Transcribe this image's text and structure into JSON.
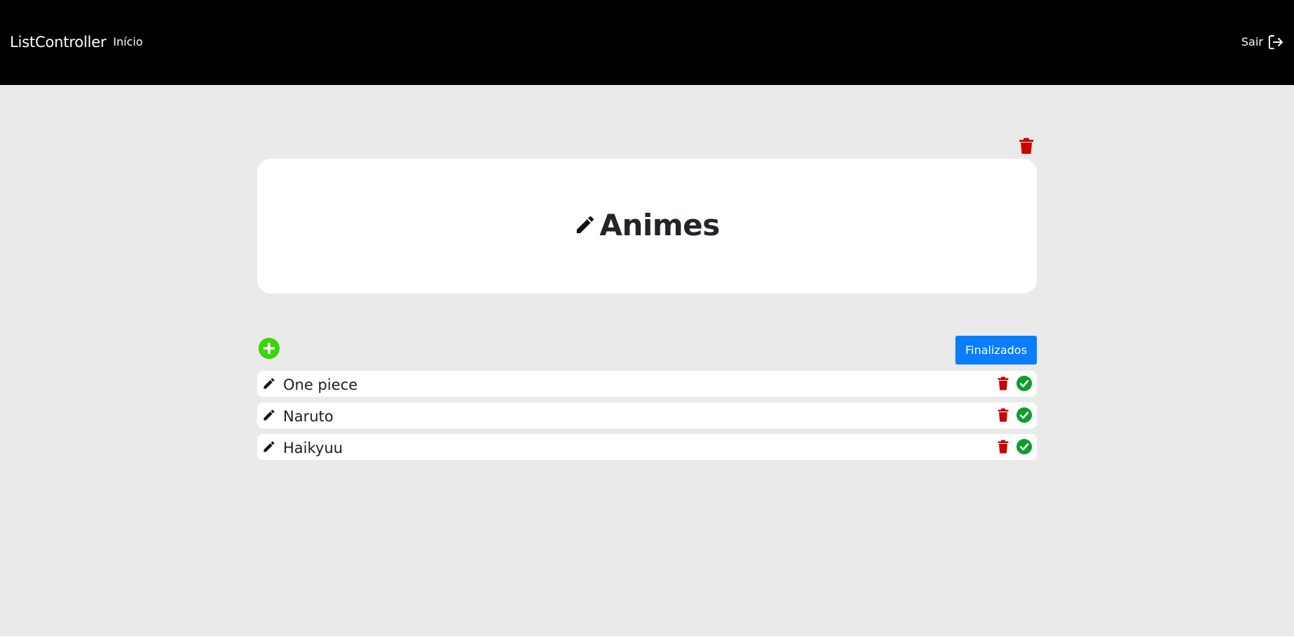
{
  "navbar": {
    "brand": "ListController",
    "home_link": "Início",
    "logout_label": "Sair",
    "logout_icon": "logout-icon"
  },
  "list": {
    "title": "Animes",
    "title_edit_icon": "pencil-icon",
    "delete_icon": "trash-icon"
  },
  "toolbar": {
    "add_icon": "plus-circle-icon",
    "finished_label": "Finalizados"
  },
  "items": [
    {
      "label": "One piece"
    },
    {
      "label": "Naruto"
    },
    {
      "label": "Haikyuu"
    }
  ],
  "colors": {
    "navbar_bg": "#000000",
    "page_bg": "#eaeaea",
    "card_bg": "#ffffff",
    "accent_blue": "#0b7dff",
    "delete_red": "#c80000",
    "done_green": "#0d9d2b",
    "add_green": "#3cd40a"
  }
}
